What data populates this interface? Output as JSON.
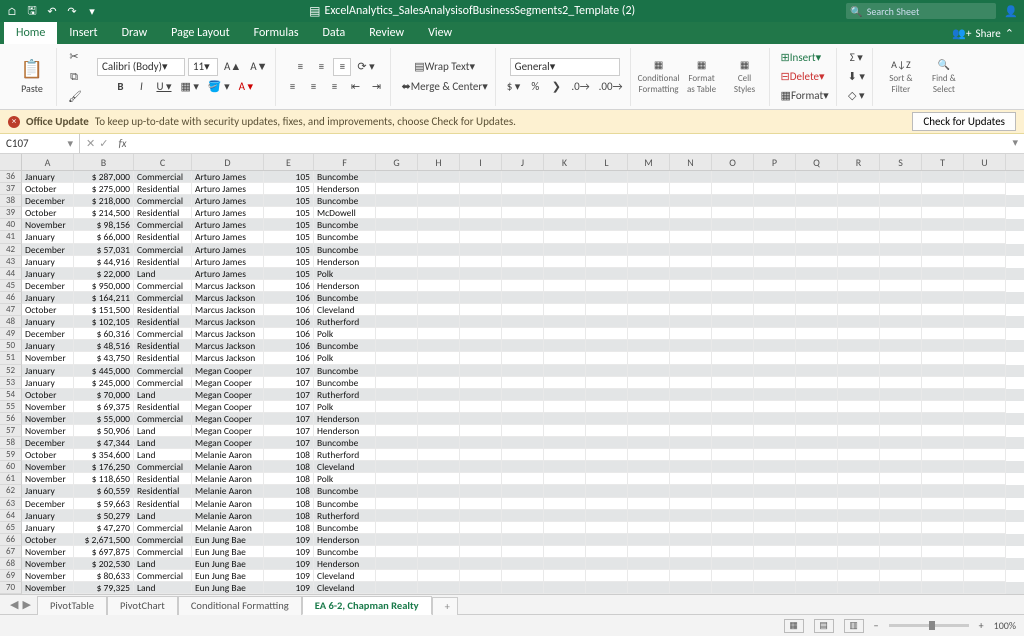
{
  "title": "ExcelAnalytics_SalesAnalysisofBusinessSegments2_Template (2)",
  "search_placeholder": "Search Sheet",
  "tabs": [
    "Home",
    "Insert",
    "Draw",
    "Page Layout",
    "Formulas",
    "Data",
    "Review",
    "View"
  ],
  "active_tab": "Home",
  "share_label": "Share",
  "ribbon": {
    "paste": "Paste",
    "font_name": "Calibri (Body)",
    "font_size": "11",
    "wrap": "Wrap Text",
    "merge": "Merge & Center",
    "num_format": "General",
    "cond_fmt": "Conditional Formatting",
    "fmt_table": "Format as Table",
    "cell_styles": "Cell Styles",
    "insert": "Insert",
    "delete": "Delete",
    "format": "Format",
    "sort": "Sort & Filter",
    "find": "Find & Select"
  },
  "update_bar": {
    "lead": "Office Update",
    "msg": "To keep up-to-date with security updates, fixes, and improvements, choose Check for Updates.",
    "button": "Check for Updates"
  },
  "namebox": "C107",
  "columns": [
    "A",
    "B",
    "C",
    "D",
    "E",
    "F",
    "G",
    "H",
    "I",
    "J",
    "K",
    "L",
    "M",
    "N",
    "O",
    "P",
    "Q",
    "R",
    "S",
    "T",
    "U"
  ],
  "rows": [
    {
      "n": 36,
      "a": "January",
      "b": "287,000",
      "c": "Commercial",
      "d": "Arturo James",
      "e": "105",
      "f": "Buncombe",
      "band": true
    },
    {
      "n": 37,
      "a": "October",
      "b": "275,000",
      "c": "Residential",
      "d": "Arturo James",
      "e": "105",
      "f": "Henderson",
      "band": false
    },
    {
      "n": 38,
      "a": "December",
      "b": "218,000",
      "c": "Commercial",
      "d": "Arturo James",
      "e": "105",
      "f": "Buncombe",
      "band": true
    },
    {
      "n": 39,
      "a": "October",
      "b": "214,500",
      "c": "Residential",
      "d": "Arturo James",
      "e": "105",
      "f": "McDowell",
      "band": false
    },
    {
      "n": 40,
      "a": "November",
      "b": "98,156",
      "c": "Commercial",
      "d": "Arturo James",
      "e": "105",
      "f": "Buncombe",
      "band": true
    },
    {
      "n": 41,
      "a": "January",
      "b": "66,000",
      "c": "Residential",
      "d": "Arturo James",
      "e": "105",
      "f": "Buncombe",
      "band": false
    },
    {
      "n": 42,
      "a": "December",
      "b": "57,031",
      "c": "Commercial",
      "d": "Arturo James",
      "e": "105",
      "f": "Buncombe",
      "band": true
    },
    {
      "n": 43,
      "a": "January",
      "b": "44,916",
      "c": "Residential",
      "d": "Arturo James",
      "e": "105",
      "f": "Henderson",
      "band": false
    },
    {
      "n": 44,
      "a": "January",
      "b": "22,000",
      "c": "Land",
      "d": "Arturo James",
      "e": "105",
      "f": "Polk",
      "band": true
    },
    {
      "n": 45,
      "a": "December",
      "b": "950,000",
      "c": "Commercial",
      "d": "Marcus Jackson",
      "e": "106",
      "f": "Henderson",
      "band": false
    },
    {
      "n": 46,
      "a": "January",
      "b": "164,211",
      "c": "Commercial",
      "d": "Marcus Jackson",
      "e": "106",
      "f": "Buncombe",
      "band": true
    },
    {
      "n": 47,
      "a": "October",
      "b": "151,500",
      "c": "Residential",
      "d": "Marcus Jackson",
      "e": "106",
      "f": "Cleveland",
      "band": false
    },
    {
      "n": 48,
      "a": "January",
      "b": "102,105",
      "c": "Residential",
      "d": "Marcus Jackson",
      "e": "106",
      "f": "Rutherford",
      "band": true
    },
    {
      "n": 49,
      "a": "December",
      "b": "60,316",
      "c": "Commercial",
      "d": "Marcus Jackson",
      "e": "106",
      "f": "Polk",
      "band": false
    },
    {
      "n": 50,
      "a": "January",
      "b": "48,516",
      "c": "Residential",
      "d": "Marcus Jackson",
      "e": "106",
      "f": "Buncombe",
      "band": true
    },
    {
      "n": 51,
      "a": "November",
      "b": "43,750",
      "c": "Residential",
      "d": "Marcus Jackson",
      "e": "106",
      "f": "Polk",
      "band": false
    },
    {
      "n": 52,
      "a": "January",
      "b": "445,000",
      "c": "Commercial",
      "d": "Megan Cooper",
      "e": "107",
      "f": "Buncombe",
      "band": true
    },
    {
      "n": 53,
      "a": "January",
      "b": "245,000",
      "c": "Commercial",
      "d": "Megan Cooper",
      "e": "107",
      "f": "Buncombe",
      "band": false
    },
    {
      "n": 54,
      "a": "October",
      "b": "70,000",
      "c": "Land",
      "d": "Megan Cooper",
      "e": "107",
      "f": "Rutherford",
      "band": true
    },
    {
      "n": 55,
      "a": "November",
      "b": "69,375",
      "c": "Residential",
      "d": "Megan Cooper",
      "e": "107",
      "f": "Polk",
      "band": false
    },
    {
      "n": 56,
      "a": "November",
      "b": "55,000",
      "c": "Commercial",
      "d": "Megan Cooper",
      "e": "107",
      "f": "Henderson",
      "band": true
    },
    {
      "n": 57,
      "a": "November",
      "b": "50,906",
      "c": "Land",
      "d": "Megan Cooper",
      "e": "107",
      "f": "Henderson",
      "band": false
    },
    {
      "n": 58,
      "a": "December",
      "b": "47,344",
      "c": "Land",
      "d": "Megan Cooper",
      "e": "107",
      "f": "Buncombe",
      "band": true
    },
    {
      "n": 59,
      "a": "October",
      "b": "354,600",
      "c": "Land",
      "d": "Melanie Aaron",
      "e": "108",
      "f": "Rutherford",
      "band": false
    },
    {
      "n": 60,
      "a": "November",
      "b": "176,250",
      "c": "Commercial",
      "d": "Melanie Aaron",
      "e": "108",
      "f": "Cleveland",
      "band": true
    },
    {
      "n": 61,
      "a": "November",
      "b": "118,650",
      "c": "Residential",
      "d": "Melanie Aaron",
      "e": "108",
      "f": "Polk",
      "band": false
    },
    {
      "n": 62,
      "a": "January",
      "b": "60,559",
      "c": "Residential",
      "d": "Melanie Aaron",
      "e": "108",
      "f": "Buncombe",
      "band": true
    },
    {
      "n": 63,
      "a": "December",
      "b": "59,663",
      "c": "Residential",
      "d": "Melanie Aaron",
      "e": "108",
      "f": "Buncombe",
      "band": false
    },
    {
      "n": 64,
      "a": "January",
      "b": "50,279",
      "c": "Land",
      "d": "Melanie Aaron",
      "e": "108",
      "f": "Rutherford",
      "band": true
    },
    {
      "n": 65,
      "a": "January",
      "b": "47,270",
      "c": "Commercial",
      "d": "Melanie Aaron",
      "e": "108",
      "f": "Buncombe",
      "band": false
    },
    {
      "n": 66,
      "a": "October",
      "b": "2,671,500",
      "c": "Commercial",
      "d": "Eun Jung Bae",
      "e": "109",
      "f": "Henderson",
      "band": true
    },
    {
      "n": 67,
      "a": "November",
      "b": "697,875",
      "c": "Commercial",
      "d": "Eun Jung Bae",
      "e": "109",
      "f": "Buncombe",
      "band": false
    },
    {
      "n": 68,
      "a": "November",
      "b": "202,530",
      "c": "Land",
      "d": "Eun Jung Bae",
      "e": "109",
      "f": "Henderson",
      "band": true
    },
    {
      "n": 69,
      "a": "November",
      "b": "80,633",
      "c": "Commercial",
      "d": "Eun Jung Bae",
      "e": "109",
      "f": "Cleveland",
      "band": false
    },
    {
      "n": 70,
      "a": "November",
      "b": "79,325",
      "c": "Land",
      "d": "Eun Jung Bae",
      "e": "109",
      "f": "Cleveland",
      "band": true
    }
  ],
  "sheets": [
    "PivotTable",
    "PivotChart",
    "Conditional Formatting",
    "EA 6-2, Chapman Realty"
  ],
  "active_sheet": "EA 6-2, Chapman Realty",
  "zoom": "100%"
}
